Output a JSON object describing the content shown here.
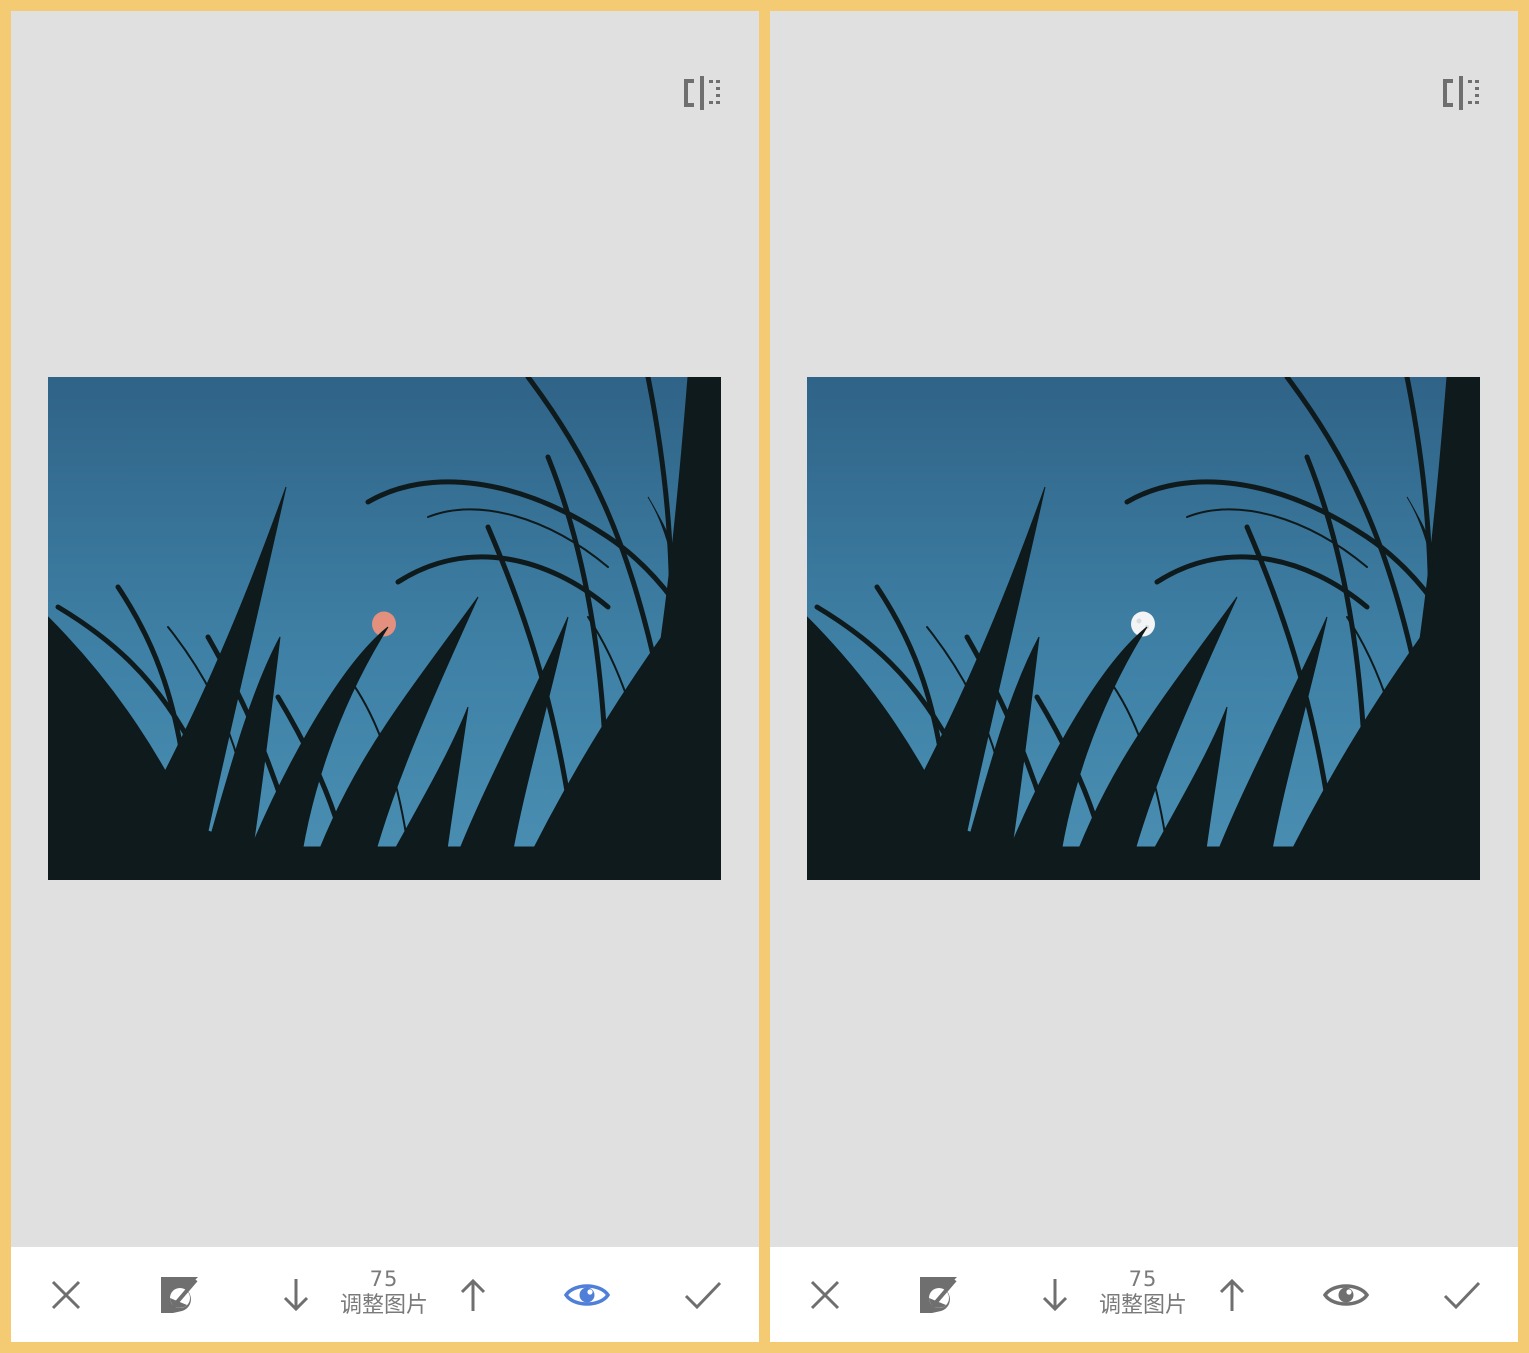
{
  "colors": {
    "frame": "#f4cb72",
    "panel_bg": "#e0e0e0",
    "toolbar_bg": "#ffffff",
    "icon_gray": "#6f6f6f",
    "eye_active": "#4f7fd8",
    "moon_masked": "#e3907e",
    "moon_original": "#f2f4f6"
  },
  "panels": [
    {
      "id": "left",
      "mask_visible": true,
      "toolbar": {
        "cancel_icon": "close-icon",
        "mask_icon": "brush-mask-icon",
        "decrease_icon": "arrow-down-icon",
        "value": "75",
        "label": "调整图片",
        "increase_icon": "arrow-up-icon",
        "eye_icon": "eye-icon",
        "apply_icon": "checkmark-icon"
      }
    },
    {
      "id": "right",
      "mask_visible": false,
      "toolbar": {
        "cancel_icon": "close-icon",
        "mask_icon": "brush-mask-icon",
        "decrease_icon": "arrow-down-icon",
        "value": "75",
        "label": "调整图片",
        "increase_icon": "arrow-up-icon",
        "eye_icon": "eye-icon",
        "apply_icon": "checkmark-icon"
      }
    }
  ]
}
